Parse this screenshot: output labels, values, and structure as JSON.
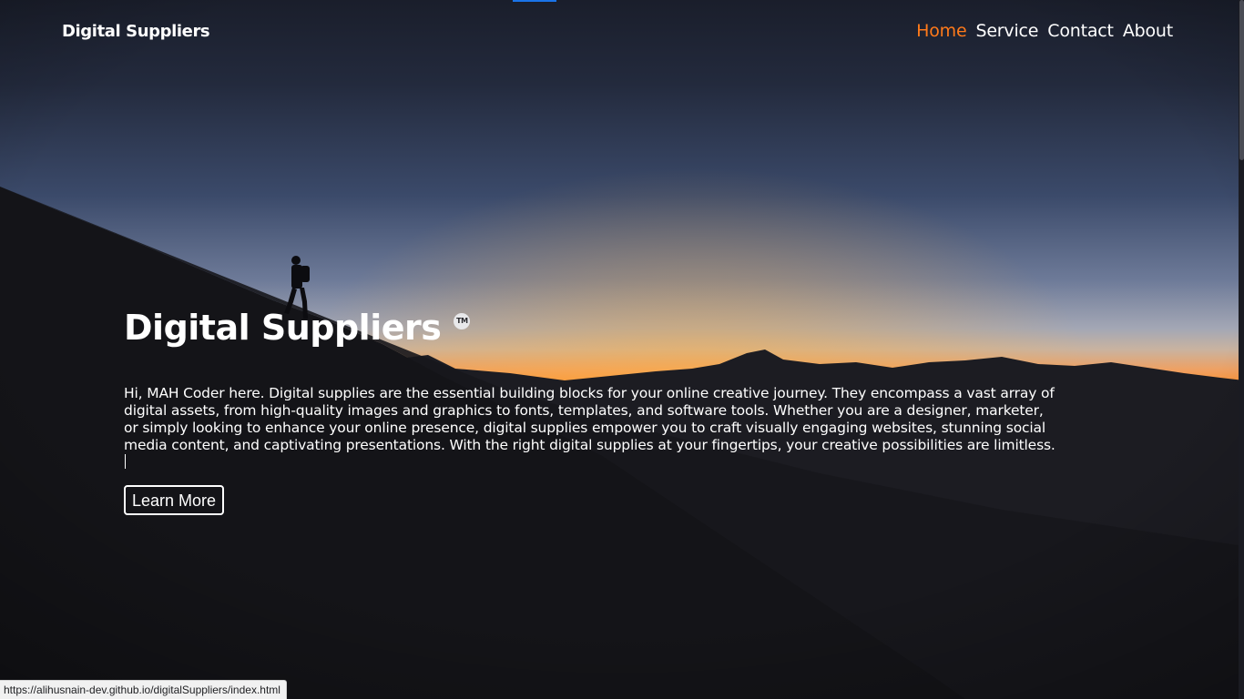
{
  "header": {
    "logo": "Digital Suppliers",
    "nav": [
      {
        "label": "Home",
        "active": true
      },
      {
        "label": "Service",
        "active": false
      },
      {
        "label": "Contact",
        "active": false
      },
      {
        "label": "About",
        "active": false
      }
    ]
  },
  "hero": {
    "title": "Digital Suppliers",
    "tm_badge": "TM",
    "body": "Hi, MAH Coder here. Digital supplies are the essential building blocks for your online creative journey. They encompass a vast array of digital assets, from high-quality images and graphics to fonts, templates, and software tools. Whether you are a designer, marketer, or simply looking to enhance your online presence, digital supplies empower you to craft visually engaging websites, stunning social media content, and captivating presentations. With the right digital supplies at your fingertips, your creative possibilities are limitless.",
    "button": "Learn More"
  },
  "status_bar": {
    "url": "https://alihusnain-dev.github.io/digitalSuppliers/index.html"
  },
  "colors": {
    "active_nav": "#ff7a1a",
    "text": "#ffffff",
    "sky_top": "#1b2030",
    "horizon_glow": "#ff9a2a"
  }
}
